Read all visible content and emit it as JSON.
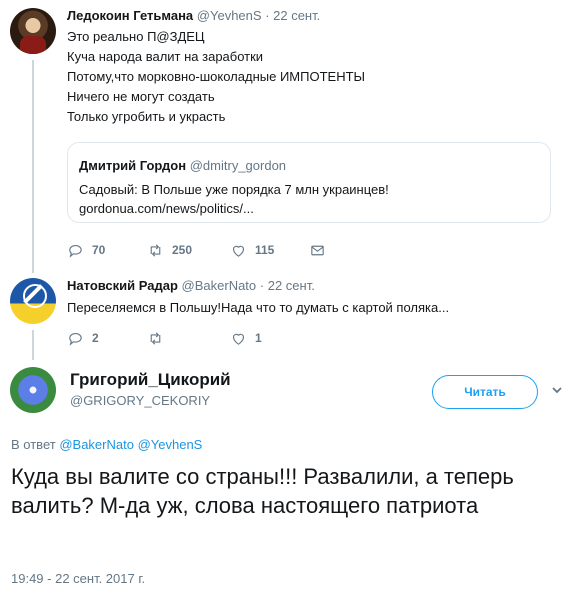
{
  "tweet1": {
    "name": "Ледокоин Гетьмана",
    "handle": "@YevhenS",
    "date": "· 22 сент.",
    "lines": [
      "Это реально П@ЗДЕЦ",
      "Куча народа валит на заработки",
      "Потому,что морковно-шоколадные ИМПОТЕНТЫ",
      "Ничего не могут создать",
      "Только угробить и украсть"
    ],
    "quote": {
      "name": "Дмитрий Гордон",
      "handle": "@dmitry_gordon",
      "text": "Садовый: В Польше уже порядка 7 млн украинцев!",
      "link": "gordonua.com/news/politics/..."
    },
    "replies": "70",
    "retweets": "250",
    "likes": "115"
  },
  "tweet2": {
    "name": "Натовский Радар",
    "handle": "@BakerNato",
    "date": "· 22 сент.",
    "text": "Переселяемся в Польшу!Нада что то думать с картой поляка...",
    "replies": "2",
    "retweets": "",
    "likes": "1"
  },
  "main": {
    "name": "Григорий_Цикорий",
    "handle": "@GRIGORY_CEKORIY",
    "follow_label": "Читать",
    "reply_prefix": "В ответ",
    "reply_users": [
      "@BakerNato",
      "@YevhenS"
    ],
    "text": "Куда вы валите со страны!!! Развалили, а теперь валить? М-да уж, слова настоящего патриота",
    "timestamp": "19:49 - 22 сент. 2017 г."
  },
  "icons": {
    "reply": "reply-icon",
    "retweet": "retweet-icon",
    "like": "heart-icon",
    "dm": "envelope-icon",
    "more": "chevron-down-icon"
  },
  "colors": {
    "accent": "#1da1f2",
    "muted": "#657786",
    "text": "#14171a",
    "border": "#e1e8ed"
  }
}
